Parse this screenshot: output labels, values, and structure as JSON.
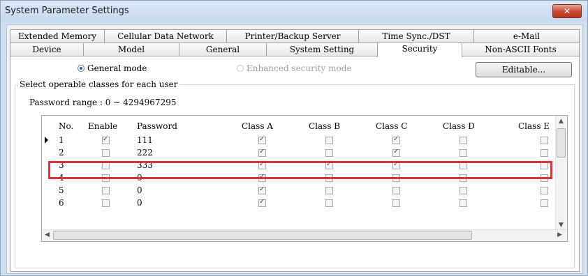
{
  "window": {
    "title": "System Parameter Settings",
    "close_label": "✕"
  },
  "tabs_row1": [
    "Extended Memory",
    "Cellular Data Network",
    "Printer/Backup Server",
    "Time Sync./DST",
    "e-Mail"
  ],
  "tabs_row2": [
    "Device",
    "Model",
    "General",
    "System Setting",
    "Security",
    "Non-ASCII Fonts"
  ],
  "active_tab": "Security",
  "mode": {
    "general_label": "General mode",
    "enhanced_label": "Enhanced security mode",
    "selected": "General mode"
  },
  "editable_label": "Editable...",
  "group_label": "Select operable classes for each user",
  "password_range": "Password range : 0 ~ 4294967295",
  "table": {
    "columns": [
      "No.",
      "Enable",
      "Password",
      "Class A",
      "Class B",
      "Class C",
      "Class D",
      "Class E"
    ],
    "rows": [
      {
        "no": "1",
        "enable": true,
        "password": "111",
        "classes": [
          true,
          false,
          true,
          false,
          false
        ]
      },
      {
        "no": "2",
        "enable": false,
        "password": "222",
        "classes": [
          true,
          false,
          true,
          false,
          false
        ]
      },
      {
        "no": "3",
        "enable": false,
        "password": "333",
        "classes": [
          true,
          true,
          true,
          false,
          false
        ]
      },
      {
        "no": "4",
        "enable": false,
        "password": "0",
        "classes": [
          true,
          false,
          false,
          false,
          false
        ]
      },
      {
        "no": "5",
        "enable": false,
        "password": "0",
        "classes": [
          true,
          false,
          false,
          false,
          false
        ]
      },
      {
        "no": "6",
        "enable": false,
        "password": "0",
        "classes": [
          true,
          false,
          false,
          false,
          false
        ]
      }
    ]
  },
  "colors": {
    "highlight": "#e2303a",
    "window_border": "#8aa3c0"
  }
}
